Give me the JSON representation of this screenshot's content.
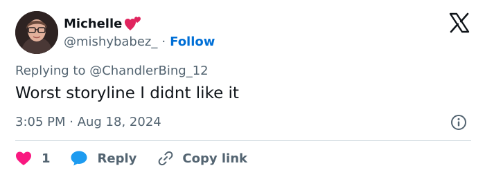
{
  "author": {
    "display_name": "Michelle",
    "handle": "@mishybabez_",
    "separator": "·",
    "follow_label": "Follow"
  },
  "tweet": {
    "replying_to": "Replying to @ChandlerBing_12",
    "text": "Worst storyline I didnt like it",
    "timestamp": "3:05 PM · Aug 18, 2024"
  },
  "actions": {
    "like_count": "1",
    "reply_label": "Reply",
    "copy_label": "Copy link"
  },
  "colors": {
    "heart": "#f91880",
    "reply_bubble": "#1d9bf0",
    "follow": "#006fd6",
    "secondary_text": "#536471"
  },
  "icons": {
    "brand": "x-logo-icon",
    "emoji": "two-hearts-icon",
    "info": "info-icon",
    "like": "heart-icon",
    "reply": "speech-bubble-icon",
    "copy": "link-icon"
  }
}
